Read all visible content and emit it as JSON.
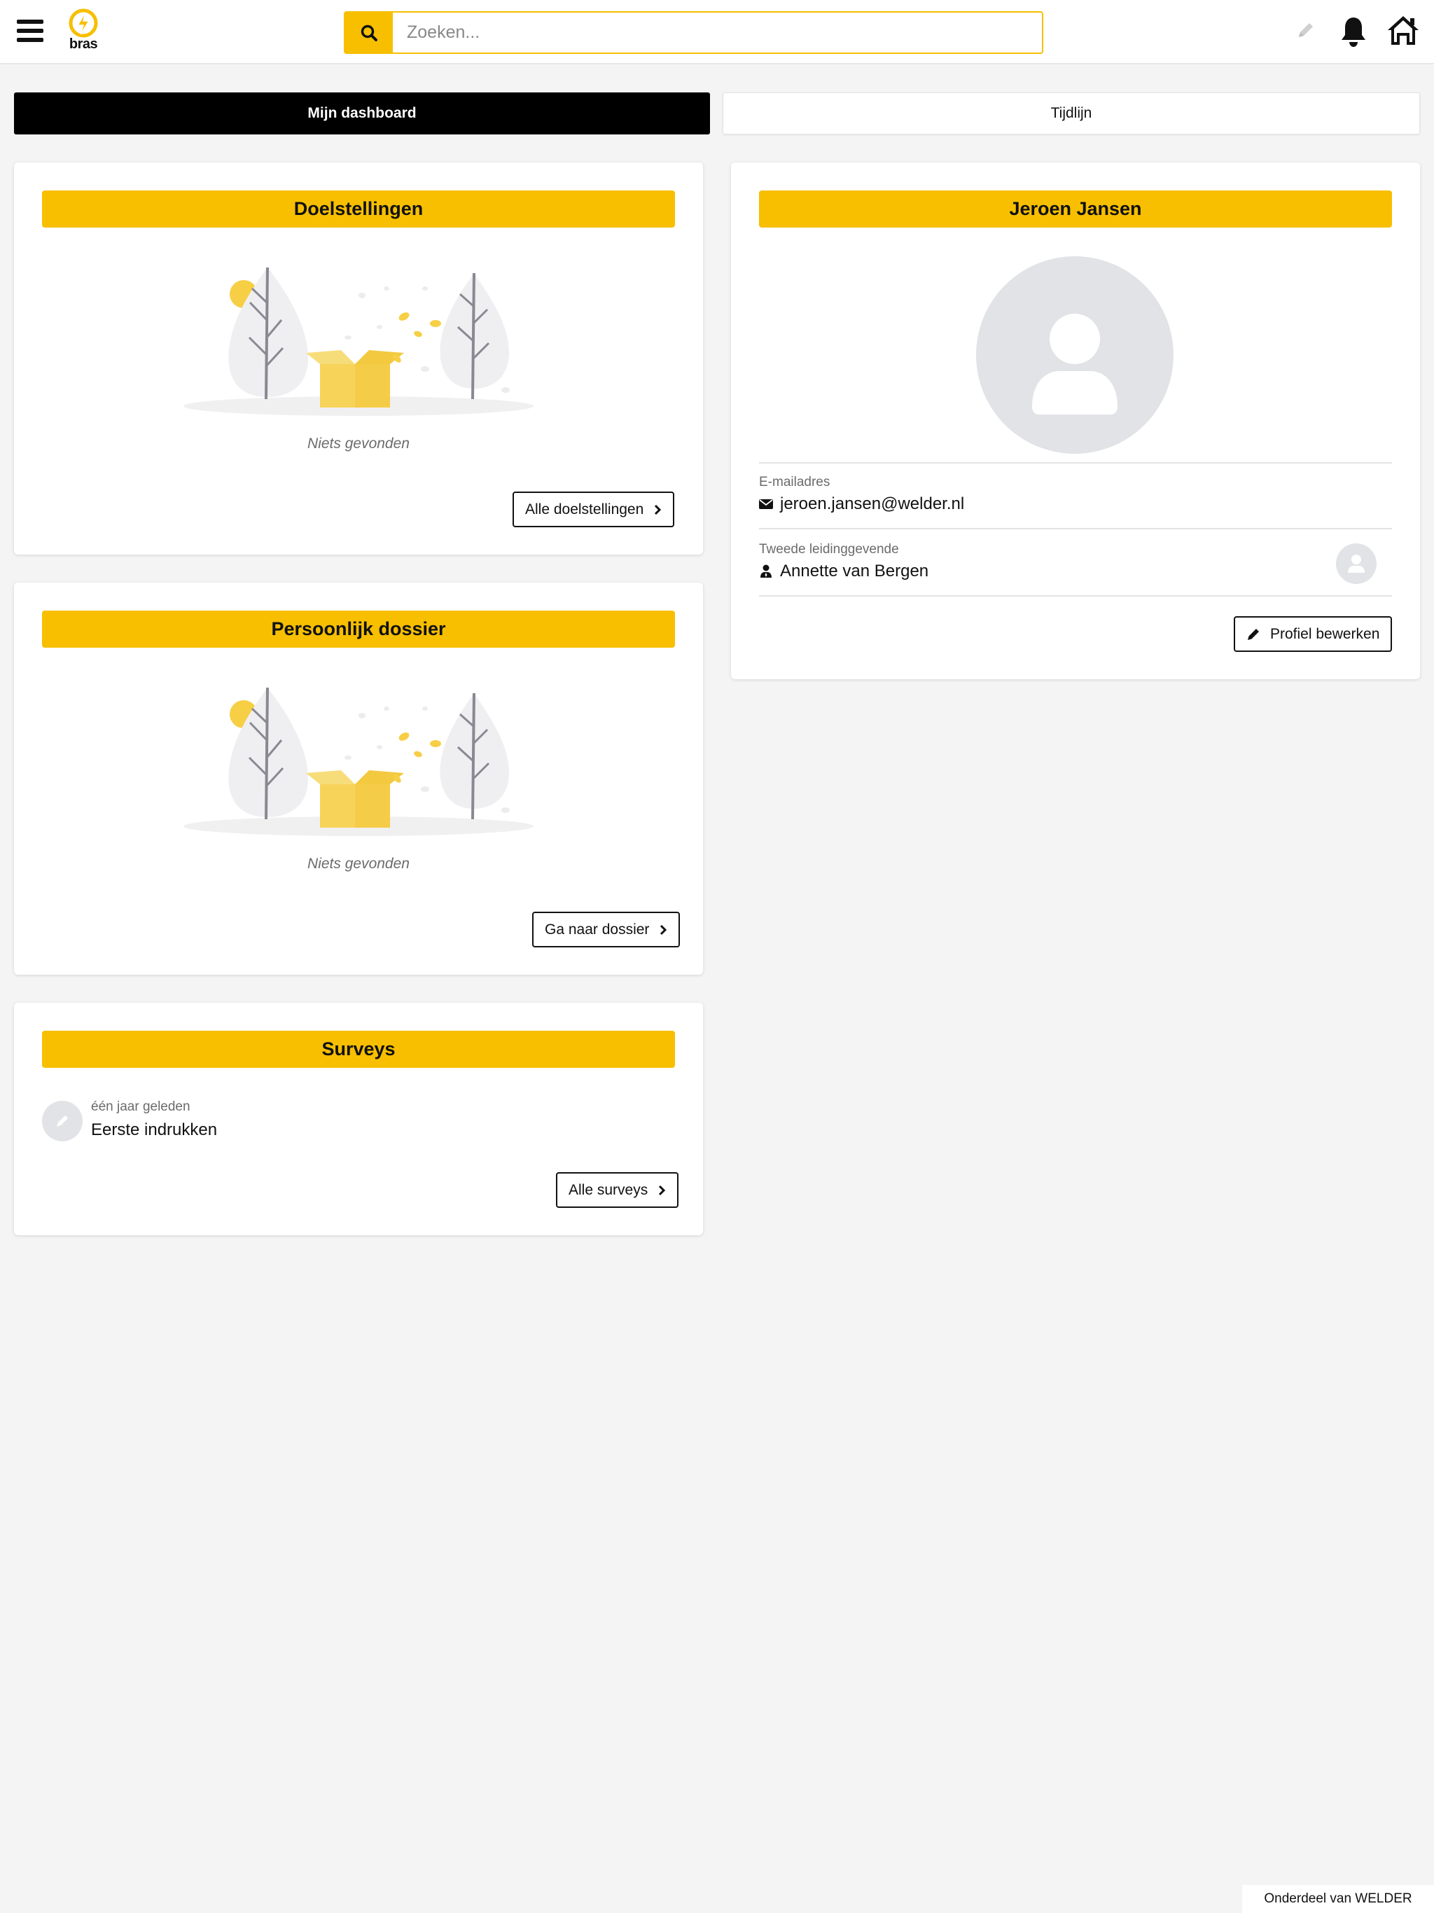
{
  "header": {
    "search_placeholder": "Zoeken...",
    "logo_text": "bras",
    "icons": [
      "menu-icon",
      "search-icon",
      "pencil-icon",
      "bell-icon",
      "home-icon"
    ]
  },
  "tabs": [
    {
      "label": "Mijn dashboard",
      "active": true
    },
    {
      "label": "Tijdlijn",
      "active": false
    }
  ],
  "goals_card": {
    "title": "Doelstellingen",
    "empty_text": "Niets gevonden",
    "button_label": "Alle doelstellingen"
  },
  "dossier_card": {
    "title": "Persoonlijk dossier",
    "empty_text": "Niets gevonden",
    "button_label": "Ga naar dossier"
  },
  "surveys_card": {
    "title": "Surveys",
    "items": [
      {
        "time": "één jaar geleden",
        "title": "Eerste indrukken"
      }
    ],
    "button_label": "Alle surveys"
  },
  "profile_card": {
    "name": "Jeroen Jansen",
    "email_label": "E-mailadres",
    "email": "jeroen.jansen@welder.nl",
    "manager_label": "Tweede leidinggevende",
    "manager": "Annette van Bergen",
    "edit_button_label": "Profiel bewerken"
  },
  "footer": {
    "text": "Onderdeel van WELDER"
  },
  "colors": {
    "accent": "#f7bf00",
    "background": "#f4f4f4",
    "tab_active": "#000000",
    "avatar_placeholder": "#e2e3e6"
  }
}
